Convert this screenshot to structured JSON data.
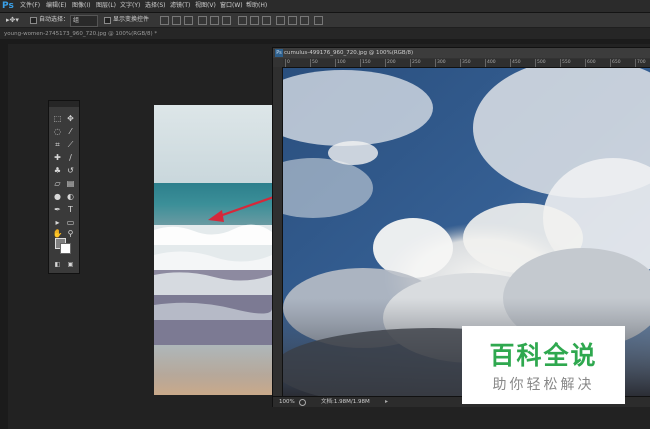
{
  "menu": {
    "logo": "Ps",
    "items": [
      "文件(F)",
      "编辑(E)",
      "图像(I)",
      "图层(L)",
      "文字(Y)",
      "选择(S)",
      "滤镜(T)",
      "视图(V)",
      "窗口(W)",
      "帮助(H)"
    ]
  },
  "options": {
    "auto_select_label": "自动选择：",
    "auto_select_value": "组",
    "transform_label": "显示变换控件"
  },
  "documents": {
    "background_tab": "young-women-2745173_960_720.jpg @ 100%(RGB/8) *",
    "cumulus_title": "cumulus-499176_960_720.jpg @ 100%(RGB/8)",
    "cumulus_icon": "Ps",
    "zoom": "100%",
    "doc_size": "文档:1.98M/1.98M"
  },
  "ruler": {
    "marks": [
      "0",
      "50",
      "100",
      "150",
      "200",
      "250",
      "300",
      "350",
      "400",
      "450",
      "500",
      "550",
      "600",
      "650",
      "700"
    ]
  },
  "watermark": {
    "main": "百科全说",
    "sub": "助你轻松解决"
  },
  "colors": {
    "foreground": "#808080",
    "background": "#ffffff",
    "arrow": "#d6283a",
    "watermark_green": "#2fa84f"
  },
  "icons": {
    "tools": [
      "marquee-icon",
      "move-icon",
      "lasso-icon",
      "magic-wand-icon",
      "crop-icon",
      "eyedropper-icon",
      "healing-brush-icon",
      "brush-icon",
      "clone-stamp-icon",
      "history-brush-icon",
      "eraser-icon",
      "gradient-icon",
      "blur-icon",
      "dodge-icon",
      "pen-icon",
      "type-icon",
      "path-select-icon",
      "shape-icon",
      "hand-icon",
      "zoom-icon"
    ]
  }
}
